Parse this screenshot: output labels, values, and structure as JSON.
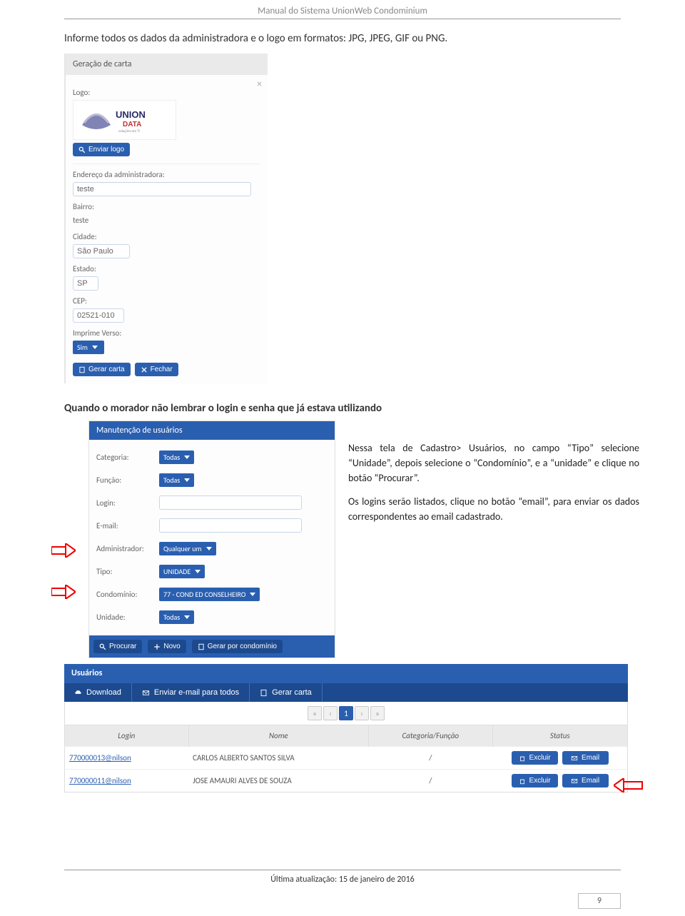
{
  "header": {
    "title": "Manual do Sistema UnionWeb Condominium"
  },
  "intro": "Informe todos os dados da administradora e o  logo em formatos: JPG, JPEG, GIF ou PNG.",
  "panel1": {
    "card_title": "Geração de carta",
    "logo_label": "Logo:",
    "upload_btn": "Enviar logo",
    "endereco_label": "Endereço da administradora:",
    "endereco_value": "teste",
    "bairro_label": "Bairro:",
    "bairro_value": "teste",
    "cidade_label": "Cidade:",
    "cidade_value": "São Paulo",
    "estado_label": "Estado:",
    "estado_value": "SP",
    "cep_label": "CEP:",
    "cep_value": "02521-010",
    "imprime_label": "Imprime Verso:",
    "imprime_value": "Sim",
    "gerar_btn": "Gerar carta",
    "fechar_btn": "Fechar"
  },
  "section2": "Quando o morador não lembrar o login e senha que já estava utilizando",
  "panel2": {
    "title": "Manutenção de usuários",
    "labels": {
      "categoria": "Categoria:",
      "funcao": "Função:",
      "login": "Login:",
      "email": "E-mail:",
      "admin": "Administrador:",
      "tipo": "Tipo:",
      "condominio": "Condomínio:",
      "unidade": "Unidade:"
    },
    "values": {
      "categoria": "Todas",
      "funcao": "Todas",
      "login": "",
      "email": "",
      "admin": "Qualquer um",
      "tipo": "UNIDADE",
      "condominio": "77 - COND ED CONSELHEIRO",
      "unidade": "Todas"
    },
    "buttons": {
      "procurar": "Procurar",
      "novo": "Novo",
      "gerar": "Gerar por condomínio"
    }
  },
  "side_text": {
    "p1": "Nessa tela de Cadastro> Usuários, no campo “Tipo” selecione “Unidade”, depois selecione o “Condomínio”, e a “unidade” e clique no botão “Procurar”.",
    "p2": "Os logins serão listados, clique no botão “email”, para enviar os dados correspondentes ao email cadastrado."
  },
  "panel3": {
    "title": "Usuários",
    "toolbar": {
      "download": "Download",
      "enviar": "Enviar e-mail para todos",
      "gerar": "Gerar carta"
    },
    "pager_current": "1",
    "columns": {
      "login": "Login",
      "nome": "Nome",
      "cat": "Categoria/Função",
      "status": "Status"
    },
    "row_btn_excluir": "Excluir",
    "row_btn_email": "Email",
    "rows": [
      {
        "login": "770000013@nilson",
        "nome": "CARLOS ALBERTO SANTOS SILVA",
        "cat": "/"
      },
      {
        "login": "770000011@nilson",
        "nome": "JOSE AMAURI ALVES DE SOUZA",
        "cat": "/"
      }
    ]
  },
  "footer": {
    "text": "Última atualização: 15 de janeiro de 2016",
    "page": "9"
  }
}
